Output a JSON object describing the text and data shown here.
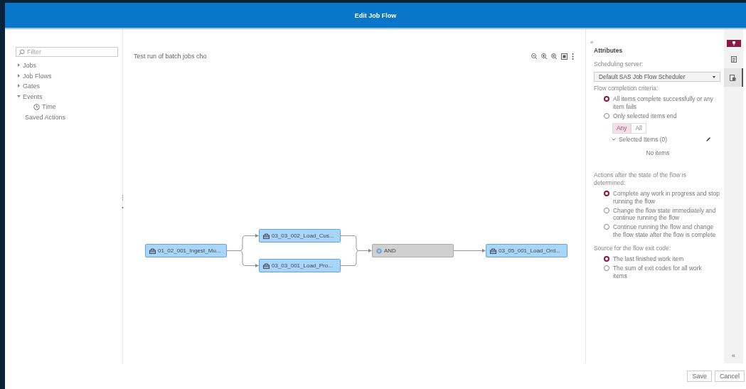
{
  "window": {
    "title": "Edit Job Flow"
  },
  "sidebar": {
    "filter": {
      "placeholder": "Filter"
    },
    "tree": [
      {
        "label": "Jobs",
        "expanded": false
      },
      {
        "label": "Job Flows",
        "expanded": false
      },
      {
        "label": "Gates",
        "expanded": false
      },
      {
        "label": "Events",
        "expanded": true,
        "children": [
          {
            "label": "Time",
            "kind": "clock"
          }
        ]
      },
      {
        "label": "Saved Actions"
      }
    ]
  },
  "canvas": {
    "description": "Test run of batch jobs cho",
    "nodes": [
      {
        "label": "01_02_001_Ingest_Mu...",
        "kind": "job"
      },
      {
        "label": "03_03_002_Load_Cus...",
        "kind": "job"
      },
      {
        "label": "03_03_001_Load_Pro...",
        "kind": "job"
      },
      {
        "label": "AND",
        "kind": "gate"
      },
      {
        "label": "03_05_001_Load_Ord...",
        "kind": "job"
      }
    ]
  },
  "attributes": {
    "collapse": "»",
    "title": "Attributes",
    "scheduling_server": {
      "label": "Scheduling server:",
      "value": "Default SAS Job Flow Scheduler"
    },
    "completion": {
      "label": "Flow completion criteria:",
      "options": [
        {
          "label": "All items complete successfully or any item fails",
          "selected": true
        },
        {
          "label": "Only selected items end",
          "selected": false
        }
      ],
      "match": [
        {
          "label": "Any",
          "selected": true
        },
        {
          "label": "All",
          "selected": false
        }
      ],
      "selected_items": {
        "label": "Selected Items (0)",
        "expanded": true,
        "empty_text": "No items"
      }
    },
    "actions": {
      "label": "Actions after the state of the flow is determined:",
      "options": [
        {
          "label": "Complete any work in progress and stop running the flow",
          "selected": true
        },
        {
          "label": "Change the flow state immediately and continue running the flow",
          "selected": false
        },
        {
          "label": "Continue running the flow and change the flow state after the flow is complete",
          "selected": false
        }
      ]
    },
    "exit_code": {
      "label": "Source for the flow exit code:",
      "options": [
        {
          "label": "The last finished work item",
          "selected": true
        },
        {
          "label": "The sum of exit codes for all work items",
          "selected": false
        }
      ]
    }
  },
  "side_tabs": [
    {
      "kind": "list",
      "selected": false
    },
    {
      "kind": "properties",
      "selected": true
    }
  ],
  "expand": "«",
  "buttons": [
    "Save",
    "Cancel"
  ]
}
